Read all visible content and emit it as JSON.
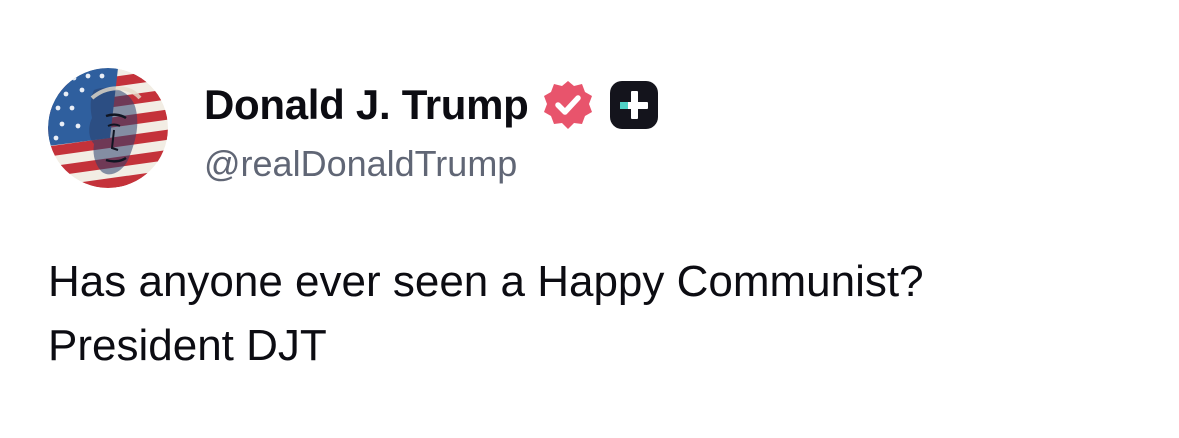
{
  "author": {
    "display_name": "Donald J. Trump",
    "handle": "@realDonaldTrump",
    "avatar_icon": "flag-portrait-avatar",
    "verified_icon": "verified-badge-icon",
    "plus_icon": "plus-subscription-icon"
  },
  "post": {
    "lines": [
      "Has anyone ever seen a Happy Communist?",
      "President DJT"
    ]
  },
  "colors": {
    "verified_badge": "#e8546c",
    "plus_badge_bg": "#14141c",
    "plus_badge_accent": "#4fd1c5",
    "handle_text": "#606675",
    "body_text": "#0c0c12"
  }
}
